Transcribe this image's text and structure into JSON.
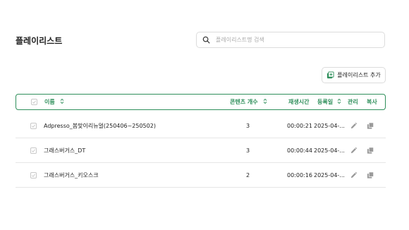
{
  "page": {
    "title": "플레이리스트"
  },
  "search": {
    "placeholder": "플레이리스트명 검색"
  },
  "toolbar": {
    "add_label": "플레이리스트 추가"
  },
  "table": {
    "headers": {
      "name": "이름",
      "content_count": "콘텐츠 개수",
      "duration": "재생시간",
      "registered": "등록일",
      "manage": "관리",
      "copy": "복사"
    },
    "rows": [
      {
        "name": "Adpresso_봄맞이리뉴얼(250406~250502)",
        "content_count": "3",
        "duration": "00:00:21",
        "registered": "2025-04-..."
      },
      {
        "name": "그래스버거스_DT",
        "content_count": "3",
        "duration": "00:00:44",
        "registered": "2025-04-..."
      },
      {
        "name": "그래스버거스_키오스크",
        "content_count": "2",
        "duration": "00:00:16",
        "registered": "2025-04-..."
      }
    ]
  },
  "icons": {
    "search": "search-icon",
    "add": "playlist-add-icon",
    "sort": "sort-icon",
    "edit": "pencil-icon",
    "copy": "copy-icon"
  },
  "colors": {
    "accent": "#2f8f5b",
    "border": "#dcdcdc",
    "icon_gray": "#9a9a9a"
  }
}
